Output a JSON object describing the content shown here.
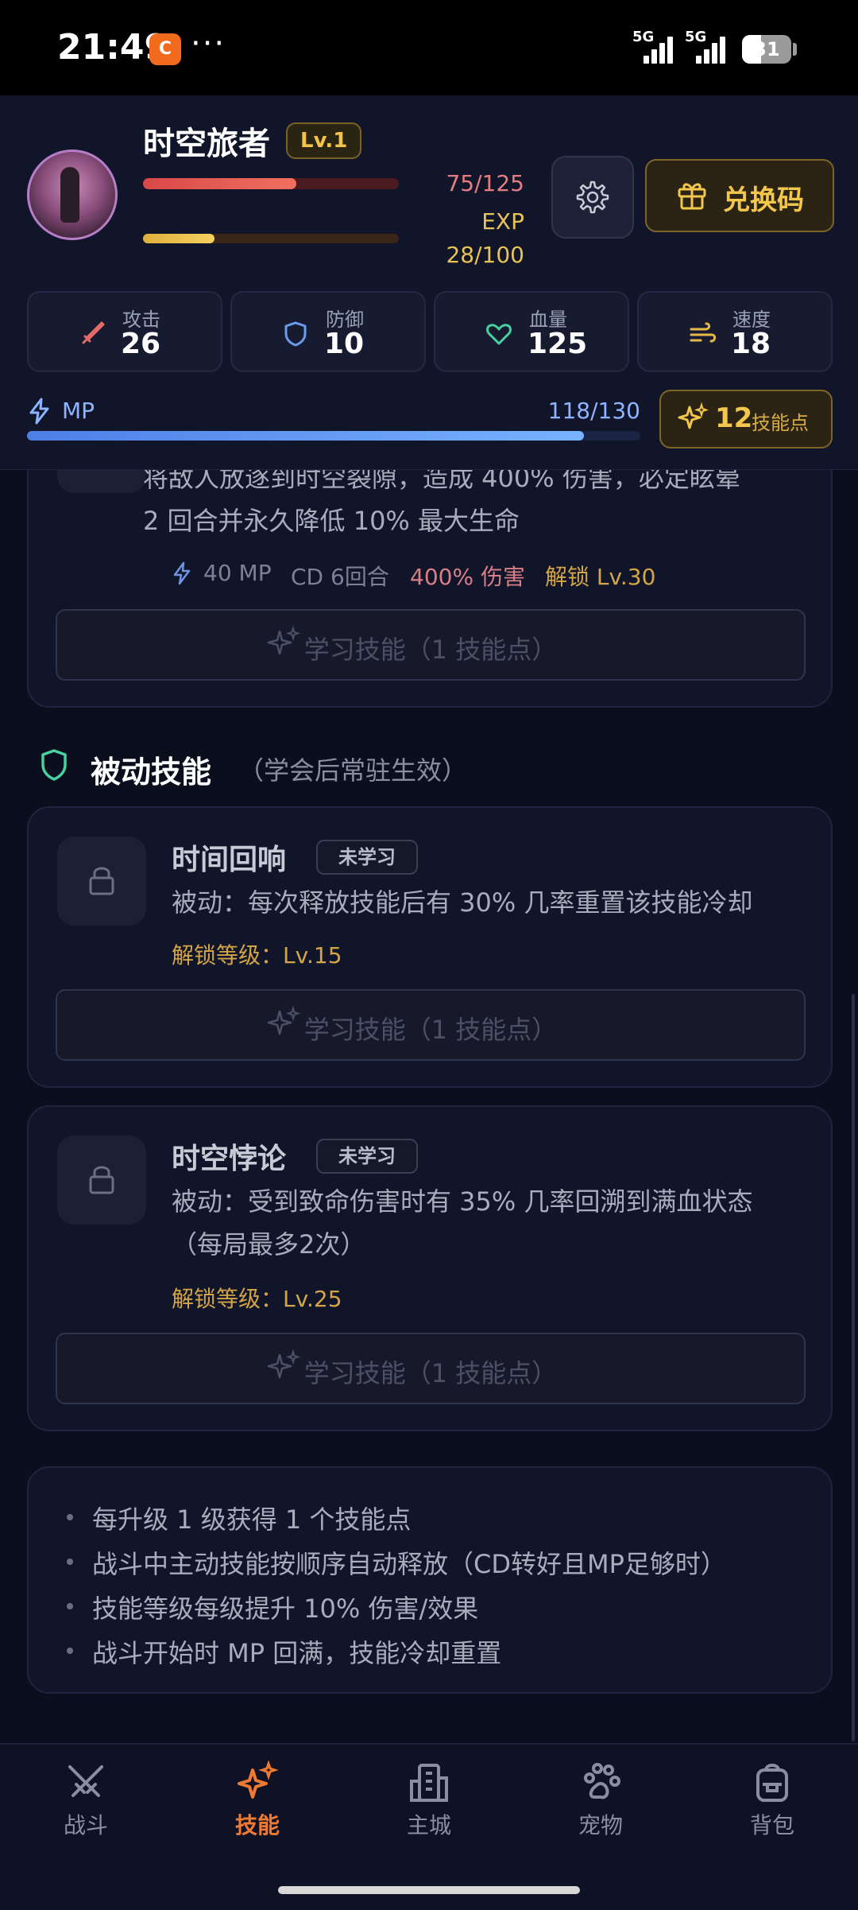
{
  "status_bar": {
    "time": "21:49",
    "app_icon_text": "C",
    "more": "···",
    "signal_label_1": "5G",
    "signal_label_2": "5G",
    "battery": "31"
  },
  "player": {
    "name": "时空旅者",
    "level": "Lv.1",
    "hp_text": "75/125",
    "hp_fraction": 0.6,
    "exp_label": "EXP",
    "exp_text": "28/100",
    "exp_fraction": 0.28
  },
  "header_buttons": {
    "settings_icon": "gear-icon",
    "redeem_label": "兑换码"
  },
  "stats": [
    {
      "label": "攻击",
      "value": "26",
      "icon": "sword-icon",
      "color": "#e46a6a"
    },
    {
      "label": "防御",
      "value": "10",
      "icon": "shield-icon",
      "color": "#6a9cf0"
    },
    {
      "label": "血量",
      "value": "125",
      "icon": "heart-icon",
      "color": "#49d0a0"
    },
    {
      "label": "速度",
      "value": "18",
      "icon": "wind-icon",
      "color": "#e7b845"
    }
  ],
  "mp": {
    "label": "MP",
    "value": "118/130",
    "fraction": 0.9077
  },
  "skill_points": {
    "count": "12",
    "label": "技能点"
  },
  "active_skill_partial": {
    "desc_line1": "将敌人放逐到时空裂隙，造成 400% 伤害，必定眩晕",
    "desc_line2": "2 回合并永久降低 10% 最大生命",
    "mp_cost": "40 MP",
    "cd": "CD 6回合",
    "damage": "400% 伤害",
    "unlock": "解锁 Lv.30",
    "learn_label": "学习技能（1 技能点）"
  },
  "passive_section": {
    "title": "被动技能",
    "subtitle": "（学会后常驻生效）"
  },
  "passive_skills": [
    {
      "name": "时间回响",
      "status": "未学习",
      "desc_line1": "被动：每次释放技能后有 30% 几率重置该技能冷却",
      "desc_line2": "",
      "unlock": "解锁等级：Lv.15",
      "learn_label": "学习技能（1 技能点）"
    },
    {
      "name": "时空悖论",
      "status": "未学习",
      "desc_line1": "被动：受到致命伤害时有 35% 几率回溯到满血状态",
      "desc_line2": "（每局最多2次）",
      "unlock": "解锁等级：Lv.25",
      "learn_label": "学习技能（1 技能点）"
    }
  ],
  "tips": [
    "每升级 1 级获得 1 个技能点",
    "战斗中主动技能按顺序自动释放（CD转好且MP足够时）",
    "技能等级每级提升 10% 伤害/效果",
    "战斗开始时 MP 回满，技能冷却重置"
  ],
  "nav": [
    {
      "label": "战斗",
      "icon": "crossed-swords-icon",
      "active": false
    },
    {
      "label": "技能",
      "icon": "sparkles-icon",
      "active": true
    },
    {
      "label": "主城",
      "icon": "building-icon",
      "active": false
    },
    {
      "label": "宠物",
      "icon": "paw-icon",
      "active": false
    },
    {
      "label": "背包",
      "icon": "backpack-icon",
      "active": false
    }
  ],
  "colors": {
    "accent_gold": "#f3c64c",
    "active_nav": "#f07a32",
    "mp_blue": "#79b2ff",
    "hp_red": "#e05555"
  }
}
